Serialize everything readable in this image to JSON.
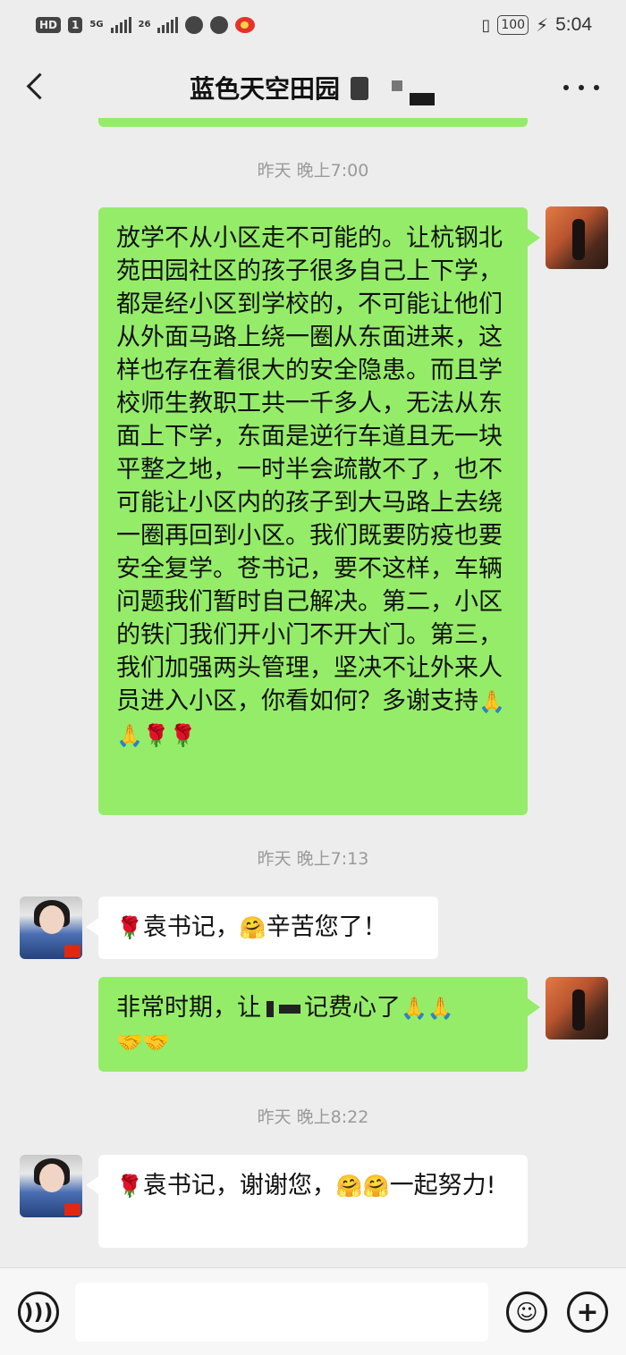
{
  "status_bar": {
    "hd": "HD",
    "sim": "1",
    "net1": "5G",
    "net2": "26",
    "battery": "100",
    "time": "5:04"
  },
  "chat": {
    "title": "蓝色天空田园"
  },
  "messages": [
    {
      "type": "timestamp",
      "text": "昨天 晚上7:00"
    },
    {
      "type": "self",
      "text": "放学不从小区走不可能的。让杭钢北苑田园社区的孩子很多自己上下学，都是经小区到学校的，不可能让他们从外面马路上绕一圈从东面进来，这样也存在着很大的安全隐患。而且学校师生教职工共一千多人，无法从东面上下学，东面是逆行车道且无一块平整之地，一时半会疏散不了，也不可能让小区内的孩子到大马路上去绕一圈再回到小区。我们既要防疫也要安全复学。苍书记，要不这样，车辆问题我们暂时自己解决。第二，小区的铁门我们开小门不开大门。第三，我们加强两头管理，坚决不让外来人员进入小区，你看如何？多谢支持"
    },
    {
      "type": "timestamp",
      "text": "昨天 晚上7:13"
    },
    {
      "type": "other",
      "text_a": "袁书记，",
      "text_b": "辛苦您了！"
    },
    {
      "type": "self",
      "text_a": "非常时期，让",
      "text_b": "记费心了"
    },
    {
      "type": "timestamp",
      "text": "昨天 晚上8:22"
    },
    {
      "type": "other",
      "text_a": "袁书记，谢谢您，",
      "text_b": "一起努力!"
    }
  ],
  "emoji": {
    "rose": "🌹",
    "hands": "🙏",
    "handshake": "🤝",
    "hug": "🤗"
  },
  "icons": {
    "back": "chevron-left-icon",
    "more": "more-icon",
    "voice": "voice-icon",
    "emoji": "smiley-icon",
    "plus": "plus-icon"
  },
  "colors": {
    "background": "#ededed",
    "self_bubble": "#95ec69",
    "other_bubble": "#ffffff",
    "timestamp": "#9a9a9a"
  }
}
